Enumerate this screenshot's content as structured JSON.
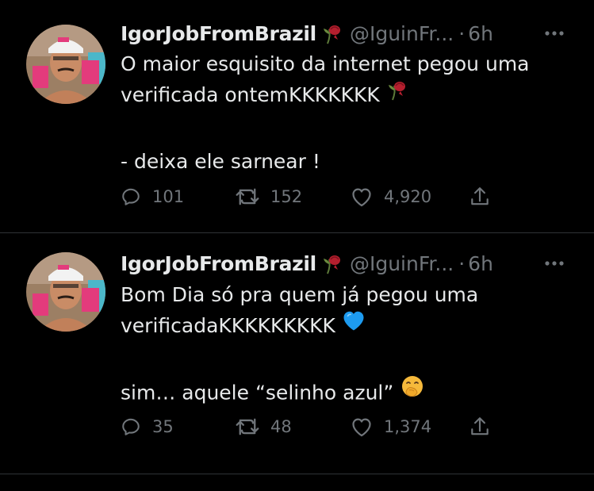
{
  "tweets": [
    {
      "display_name": "IgorJobFromBrazil",
      "name_emoji": "wilted-rose",
      "handle": "@IguinFr...",
      "separator": "·",
      "time": "6h",
      "lines": [
        "O maior esquisito da internet pegou uma",
        "verificada ontemKKKKKKK",
        "",
        "- deixa ele sarnear !"
      ],
      "line_emoji": "wilted-rose",
      "replies": "101",
      "retweets": "152",
      "likes": "4,920"
    },
    {
      "display_name": "IgorJobFromBrazil",
      "name_emoji": "wilted-rose",
      "handle": "@IguinFr...",
      "separator": "·",
      "time": "6h",
      "lines": [
        "Bom Dia só pra quem já pegou uma",
        "verificadaKKKKKKKKK",
        "",
        "sim… aquele “selinho azul”"
      ],
      "line_emoji_1": "blue-heart",
      "line_emoji_3": "face-with-hand-over-mouth",
      "replies": "35",
      "retweets": "48",
      "likes": "1,374"
    }
  ],
  "icons": {
    "reply": "reply-icon",
    "retweet": "retweet-icon",
    "like": "heart-icon",
    "share": "share-icon",
    "more": "more-icon"
  },
  "colors": {
    "background": "#000000",
    "text": "#e7e9ea",
    "muted": "#71767b",
    "divider": "#2f3336",
    "blue_heart": "#1d9bf0"
  }
}
